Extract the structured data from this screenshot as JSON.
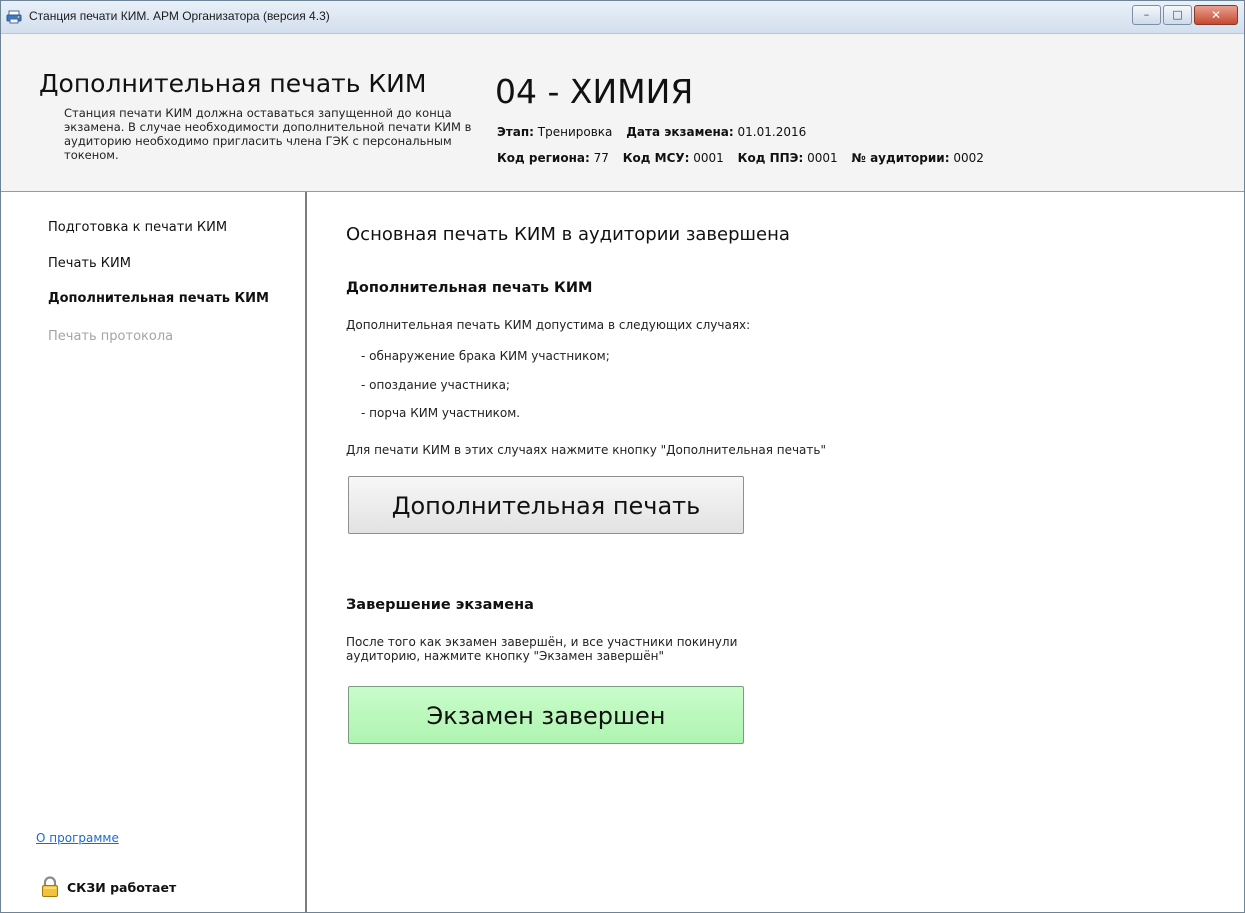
{
  "window": {
    "title": "Станция печати КИМ. АРМ Организатора (версия 4.3)",
    "buttons": {
      "minimize": "–",
      "maximize": "□",
      "close": "✕"
    }
  },
  "header": {
    "title": "Дополнительная печать КИМ",
    "description": "Станция печати КИМ должна оставаться запущенной до конца экзамена. В случае необходимости дополнительной печати КИМ в аудиторию необходимо пригласить члена ГЭК с персональным токеном.",
    "subject": "04 - ХИМИЯ",
    "stage_label": "Этап:",
    "stage_value": "Тренировка",
    "exam_date_label": "Дата экзамена:",
    "exam_date_value": "01.01.2016",
    "region_label": "Код региона:",
    "region_value": "77",
    "msu_label": "Код МСУ:",
    "msu_value": "0001",
    "ppe_label": "Код ППЭ:",
    "ppe_value": "0001",
    "room_label": "№ аудитории:",
    "room_value": "0002"
  },
  "sidebar": {
    "items": [
      {
        "label": "Подготовка к печати КИМ",
        "state": "normal"
      },
      {
        "label": "Печать КИМ",
        "state": "normal"
      },
      {
        "label": "Дополнительная печать КИМ",
        "state": "active"
      },
      {
        "label": "Печать протокола",
        "state": "disabled"
      }
    ],
    "about_link": "О программе",
    "skzi_status": "СКЗИ работает"
  },
  "main": {
    "heading": "Основная печать КИМ в аудитории завершена",
    "extra_print": {
      "title": "Дополнительная печать КИМ",
      "intro": "Дополнительная печать КИМ допустима в следующих случаях:",
      "cases": [
        "- обнаружение брака КИМ участником;",
        "- опоздание участника;",
        "- порча КИМ участником."
      ],
      "instruction": "Для печати КИМ в этих случаях нажмите кнопку \"Дополнительная печать\"",
      "button_label": "Дополнительная печать"
    },
    "finish": {
      "title": "Завершение экзамена",
      "instruction": "После того как экзамен завершён, и все участники покинули аудиторию, нажмите кнопку \"Экзамен завершён\"",
      "button_label": "Экзамен завершен"
    }
  },
  "colors": {
    "finish_button": "#b8f7bb",
    "link": "#1a6ccf",
    "disabled_text": "#a5a5a5"
  }
}
